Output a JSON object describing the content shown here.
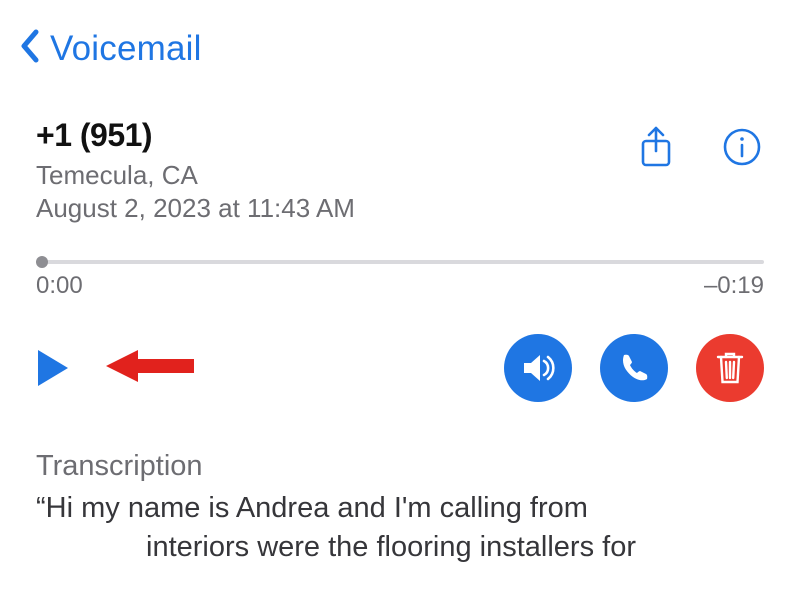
{
  "nav": {
    "back_label": "Voicemail"
  },
  "caller": {
    "number": "+1 (951)",
    "location": "Temecula, CA",
    "timestamp": "August 2, 2023 at 11:43 AM"
  },
  "scrubber": {
    "elapsed": "0:00",
    "remaining": "–0:19"
  },
  "icons": {
    "share": "share-icon",
    "info": "info-icon",
    "play": "play-icon",
    "speaker": "speaker-icon",
    "call": "phone-icon",
    "delete": "trash-icon",
    "annotation": "red-arrow-icon"
  },
  "transcription": {
    "heading": "Transcription",
    "line1": "“Hi my name is Andrea and I'm calling from",
    "line2": "interiors were the flooring installers for"
  },
  "colors": {
    "accent": "#1f76e3",
    "danger": "#eb3b2f",
    "annotation": "#e1221d",
    "muted": "#6d6d72"
  }
}
